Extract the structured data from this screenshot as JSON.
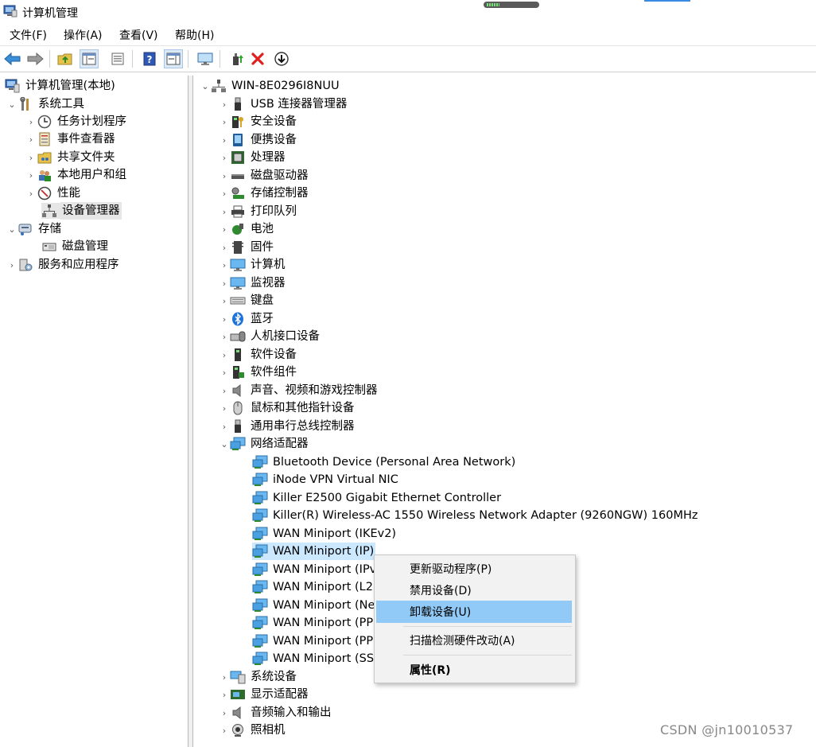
{
  "window": {
    "title": "计算机管理"
  },
  "menubar": [
    "文件(F)",
    "操作(A)",
    "查看(V)",
    "帮助(H)"
  ],
  "toolbar": [
    "back-arrow-icon",
    "forward-arrow-icon",
    "folder-up-icon",
    "show-hide-tree-icon",
    "export-list-icon",
    "help-icon",
    "show-action-pane-icon",
    "monitor-icon",
    "update-driver-icon",
    "uninstall-x-icon",
    "download-arrow-icon"
  ],
  "left_tree": {
    "root": "计算机管理(本地)",
    "system_tools": "系统工具",
    "task_scheduler": "任务计划程序",
    "event_viewer": "事件查看器",
    "shared_folders": "共享文件夹",
    "local_users": "本地用户和组",
    "performance": "性能",
    "device_manager": "设备管理器",
    "storage": "存储",
    "disk_management": "磁盘管理",
    "services_apps": "服务和应用程序"
  },
  "device_tree": {
    "computer_name": "WIN-8E0296I8NUU",
    "categories": [
      "USB 连接器管理器",
      "安全设备",
      "便携设备",
      "处理器",
      "磁盘驱动器",
      "存储控制器",
      "打印队列",
      "电池",
      "固件",
      "计算机",
      "监视器",
      "键盘",
      "蓝牙",
      "人机接口设备",
      "软件设备",
      "软件组件",
      "声音、视频和游戏控制器",
      "鼠标和其他指针设备",
      "通用串行总线控制器",
      "网络适配器"
    ],
    "network_adapters": [
      "Bluetooth Device (Personal Area Network)",
      "iNode VPN Virtual NIC",
      "Killer E2500 Gigabit Ethernet Controller",
      "Killer(R) Wireless-AC 1550 Wireless Network Adapter (9260NGW) 160MHz",
      "WAN Miniport (IKEv2)",
      "WAN Miniport (IP)",
      "WAN Miniport (IPv",
      "WAN Miniport (L2",
      "WAN Miniport (Ne",
      "WAN Miniport (PP",
      "WAN Miniport (PP",
      "WAN Miniport (SS"
    ],
    "categories_after": [
      "系统设备",
      "显示适配器",
      "音频输入和输出",
      "照相机"
    ]
  },
  "context_menu": {
    "update_driver": "更新驱动程序(P)",
    "disable_device": "禁用设备(D)",
    "uninstall_device": "卸载设备(U)",
    "scan_hardware": "扫描检测硬件改动(A)",
    "properties": "属性(R)"
  },
  "watermark": "CSDN @jn10010537",
  "colors": {
    "selection": "#cce8ff",
    "menu_highlight": "#91c9f7",
    "uninstall_red": "#e02020"
  }
}
